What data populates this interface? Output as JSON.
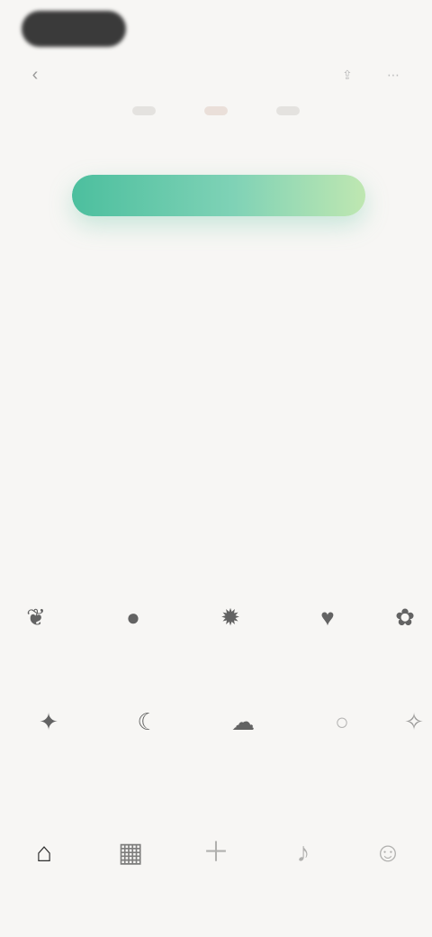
{
  "topbar": {
    "back_icon": "back-arrow-icon",
    "right_icons": [
      "share-icon",
      "more-icon"
    ]
  },
  "carousel": {
    "count": 3,
    "active_index": 1
  },
  "progress": {
    "value_percent": 100,
    "caption": ""
  },
  "hero": {
    "headline": "",
    "subline": ""
  },
  "grid": {
    "row1": [
      {
        "icon": "leaf-icon",
        "label": ""
      },
      {
        "icon": "drop-icon",
        "label": ""
      },
      {
        "icon": "sun-icon",
        "label": ""
      },
      {
        "icon": "heart-icon",
        "label": ""
      },
      {
        "icon": "flower-icon",
        "label": ""
      }
    ],
    "row2": [
      {
        "icon": "star-icon",
        "label": ""
      },
      {
        "icon": "moon-icon",
        "label": ""
      },
      {
        "icon": "cloud-icon",
        "label": ""
      },
      {
        "icon": "circle-icon",
        "label": ""
      },
      {
        "icon": "spark-icon",
        "label": ""
      }
    ]
  },
  "bottom_nav": [
    {
      "icon": "home-icon",
      "label": ""
    },
    {
      "icon": "chart-icon",
      "label": ""
    },
    {
      "icon": "add-icon",
      "label": ""
    },
    {
      "icon": "bell-icon",
      "label": ""
    },
    {
      "icon": "user-icon",
      "label": ""
    }
  ],
  "colors": {
    "background": "#f7f6f4",
    "accent_start": "#4cbf9e",
    "accent_end": "#bfe7b1"
  }
}
